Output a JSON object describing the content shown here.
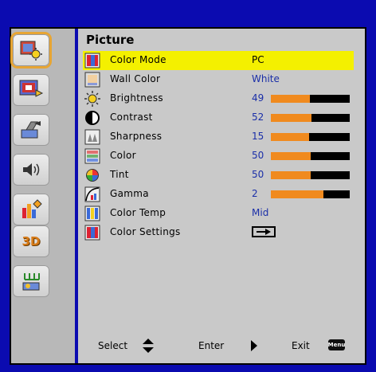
{
  "header": {
    "title": "Picture"
  },
  "sidebar": {
    "items": [
      {
        "icon": "picture-icon",
        "active": true
      },
      {
        "icon": "display-icon",
        "active": false
      },
      {
        "icon": "setup-icon",
        "active": false
      },
      {
        "icon": "volume-icon",
        "active": false
      },
      {
        "icon": "options-icon",
        "active": false
      },
      {
        "icon": "3d-icon",
        "label": "3D",
        "active": false
      },
      {
        "icon": "lan-icon",
        "active": false
      }
    ]
  },
  "menu": {
    "items": [
      {
        "label": "Color Mode",
        "value": "PC",
        "selected": true,
        "icon": "color-mode-icon"
      },
      {
        "label": "Wall Color",
        "value": "White",
        "icon": "wall-color-icon"
      },
      {
        "label": "Brightness",
        "value": "49",
        "level": 49,
        "icon": "brightness-icon"
      },
      {
        "label": "Contrast",
        "value": "52",
        "level": 52,
        "icon": "contrast-icon"
      },
      {
        "label": "Sharpness",
        "value": "15",
        "level": 15,
        "max": 31,
        "icon": "sharpness-icon"
      },
      {
        "label": "Color",
        "value": "50",
        "level": 50,
        "icon": "color-icon"
      },
      {
        "label": "Tint",
        "value": "50",
        "level": 50,
        "icon": "tint-icon"
      },
      {
        "label": "Gamma",
        "value": "2",
        "level": 2,
        "max": 3,
        "icon": "gamma-icon"
      },
      {
        "label": "Color Temp",
        "value": "Mid",
        "icon": "color-temp-icon"
      },
      {
        "label": "Color Settings",
        "icon": "color-settings-icon",
        "enter": true
      }
    ]
  },
  "footer": {
    "select_label": "Select",
    "enter_label": "Enter",
    "exit_label": "Exit",
    "menu_badge": "Menu"
  },
  "colors": {
    "background": "#0b0bb0",
    "panel": "#c9c9c9",
    "sidebar": "#b8b8b8",
    "highlight": "#f4f000",
    "bar_fill": "#f08a1e",
    "value_text": "#1a2ea8"
  }
}
